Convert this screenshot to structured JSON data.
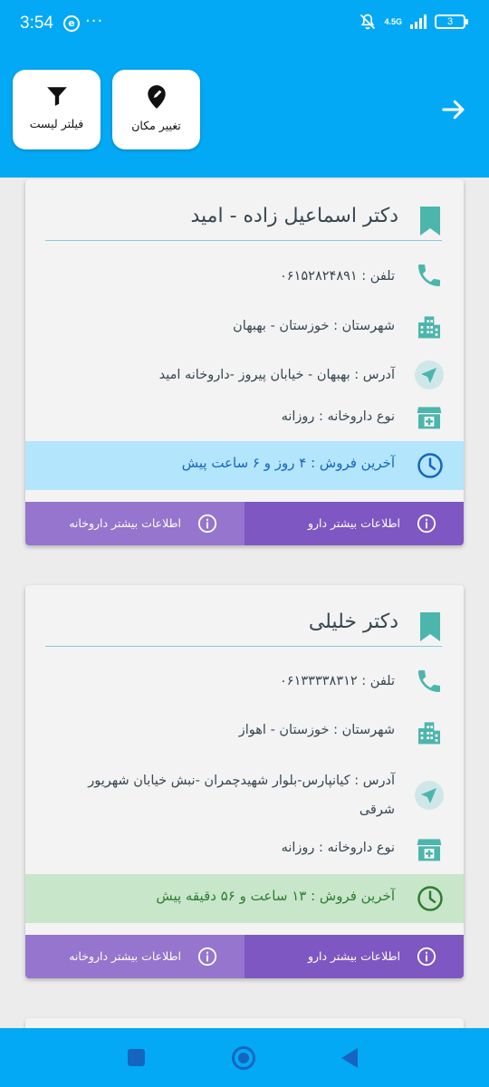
{
  "status_bar": {
    "time": "3:54",
    "dots": "···",
    "network": "4.5G",
    "battery": "3"
  },
  "header": {
    "filter_label": "فیلتر لیست",
    "location_label": "تغییر مکان"
  },
  "pharmacies": [
    {
      "name": "دکتر اسماعیل زاده - امید",
      "phone": "تلفن : ۰۶۱۵۲۸۲۴۸۹۱",
      "city": "شهرستان : خوزستان - بهبهان",
      "address": "آدرس : بهبهان - خیابان پیروز -داروخانه امید",
      "type": "نوع داروخانه : روزانه",
      "last_sale": "آخرین فروش : ۴ روز و ۶ ساعت پیش",
      "last_sale_bg": "#B3E5FC",
      "last_sale_color": "#1565C0",
      "more_drug_label": "اطلاعات بیشتر دارو",
      "more_pharmacy_label": "اطلاعات بیشتر داروخانه"
    },
    {
      "name": "دکتر خلیلی",
      "phone": "تلفن : ۰۶۱۳۳۳۳۸۳۱۲",
      "city": "شهرستان : خوزستان - اهواز",
      "address": "آدرس : کیانپارس-بلوار شهیدچمران -نبش خیابان شهریور شرقی",
      "type": "نوع داروخانه : روزانه",
      "last_sale": "آخرین فروش : ۱۳ ساعت و ۵۶ دقیقه پیش",
      "last_sale_bg": "#C8E6C9",
      "last_sale_color": "#2E7D32",
      "more_drug_label": "اطلاعات بیشتر دارو",
      "more_pharmacy_label": "اطلاعات بیشتر داروخانه"
    }
  ],
  "colors": {
    "primary": "#03A9F4",
    "accent_teal": "#4DB6AC",
    "purple_dark": "#7E57C2",
    "purple_light": "#9575CD"
  },
  "icons": [
    "filter-icon",
    "location-pin-icon",
    "back-arrow-icon",
    "bookmark-icon",
    "phone-icon",
    "city-icon",
    "send-icon",
    "store-icon",
    "clock-icon",
    "info-icon"
  ]
}
